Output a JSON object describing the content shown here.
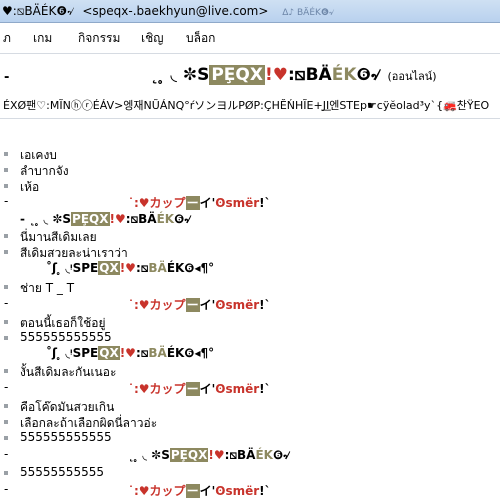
{
  "window": {
    "title_name": "♥:⧅BÄÉK❻৵",
    "title_email": "<speqx-.baekhyun@live.com>",
    "title_ghost": "Δ♪ BÄÉK❻৵"
  },
  "menu": [
    "ภ",
    "เกม",
    "กิจกรรม",
    "เชิญ",
    "บล็อก"
  ],
  "header": {
    "dash": "-",
    "contact": {
      "pre": "˛ ̥ ◟ ✼S",
      "hl": "PȨQX",
      "red": "!♥",
      "mid": ":⧅BÄ",
      "olive": "ÉK",
      "post": "❻৵"
    },
    "status": "(ออนไลน์)",
    "psm": "ÉXØ팬♡:MĨNⓗⓡÉÁV>엥재NŨÁNQ°ŕソンヨルPØP:ÇHĔŃHĨE+J͟I엔STEp☛cÿĕolad³y`{🚒찬ŸEO"
  },
  "sender_me": {
    "pre": "˙:♥カップ",
    "hl": "ー",
    "mid": "イ'",
    "mer": "ʘsmër",
    "post": "!`"
  },
  "sender_you_name": {
    "pre": "˛ ̥ ◟ ✼S",
    "hl": "PȨQX",
    "red": "!♥",
    "mid": ":⧅BÄ",
    "olive": "ÉK",
    "post": "❻৵"
  },
  "sender_you_alt": {
    "pre": "˚ʃ ̥ ◟ᵎSPE",
    "hl": "QX",
    "red": "!♥",
    "mid": ":⧅",
    "olive": "BÄ",
    "post": "ÉK❻◂¶°"
  },
  "sender_you_dash": {
    "pre": "- ˛ ̥ ◟ ✼S",
    "hl": "PȨQX",
    "red": "!♥",
    "mid": ":⧅BÄ",
    "olive": "ÉK",
    "post": "❻৵"
  },
  "messages": [
    {
      "text": "เอเคงบ"
    },
    {
      "text": "ลำบากจัง"
    },
    {
      "text": "เห้อ"
    },
    {
      "text": "นี่มานสีเดิมเลย"
    },
    {
      "text": "สีเดิมสวยละน่าเราว่า"
    },
    {
      "text": "ช่าย T _ T"
    },
    {
      "text": "ตอนนี้เธอก็ใช้อยู่"
    },
    {
      "text": "555555555555"
    },
    {
      "text": "งั้นสีเดิมละกันเนอะ"
    },
    {
      "text": "คือโค๊ดมันสวยเกิน"
    },
    {
      "text": "เลือกละถ้าเลือกผิดนี่ลาวอ่ะ"
    },
    {
      "text": "555555555555"
    },
    {
      "text": "55555555555"
    }
  ]
}
